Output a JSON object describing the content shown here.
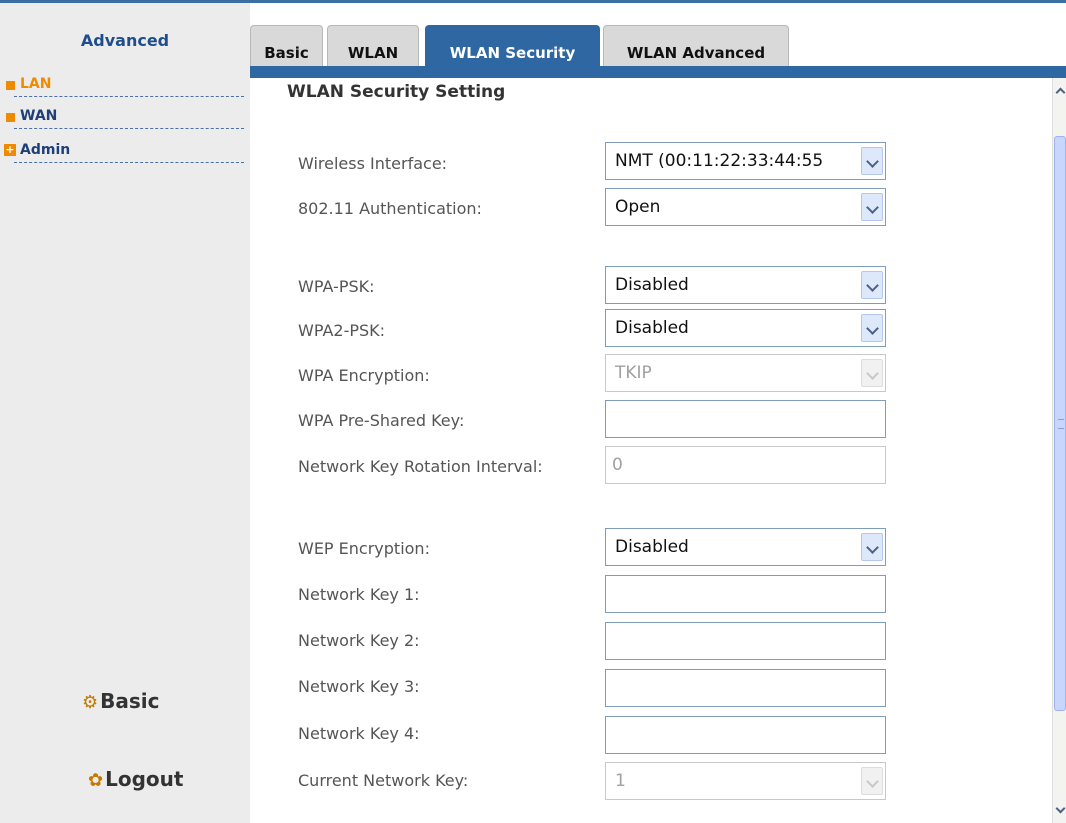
{
  "sidebar": {
    "title": "Advanced",
    "items": [
      {
        "label": "LAN",
        "icon": "orange-square-bullet"
      },
      {
        "label": "WAN",
        "icon": "orange-square-bullet"
      },
      {
        "label": "Admin",
        "icon": "plus-expand-icon"
      }
    ],
    "basic_button": {
      "label": "Basic",
      "icon": "gear-icon"
    },
    "logout_button": {
      "label": "Logout",
      "icon": "logout-icon"
    }
  },
  "tabs": [
    {
      "label": "Basic",
      "active": false
    },
    {
      "label": "WLAN",
      "active": false
    },
    {
      "label": "WLAN Security",
      "active": true
    },
    {
      "label": "WLAN Advanced",
      "active": false
    }
  ],
  "page": {
    "title": "WLAN Security Setting",
    "fields": {
      "wireless_interface": {
        "label": "Wireless Interface:",
        "value": "NMT (00:11:22:33:44:55"
      },
      "auth": {
        "label": "802.11 Authentication:",
        "value": "Open"
      },
      "wpa_psk": {
        "label": "WPA-PSK:",
        "value": "Disabled"
      },
      "wpa2_psk": {
        "label": "WPA2-PSK:",
        "value": "Disabled"
      },
      "wpa_encryption": {
        "label": "WPA Encryption:",
        "value": "TKIP"
      },
      "wpa_key": {
        "label": "WPA Pre-Shared Key:",
        "value": ""
      },
      "rotation": {
        "label": "Network Key Rotation Interval:",
        "value": "0"
      },
      "wep_encryption": {
        "label": "WEP Encryption:",
        "value": "Disabled"
      },
      "key1": {
        "label": "Network Key 1:",
        "value": ""
      },
      "key2": {
        "label": "Network Key 2:",
        "value": ""
      },
      "key3": {
        "label": "Network Key 3:",
        "value": ""
      },
      "key4": {
        "label": "Network Key 4:",
        "value": ""
      },
      "current_key": {
        "label": "Current Network Key:",
        "value": "1"
      }
    }
  },
  "colors": {
    "accent_blue": "#2f67a3",
    "orange": "#f08a00",
    "sidebar_bg": "#ececec"
  }
}
